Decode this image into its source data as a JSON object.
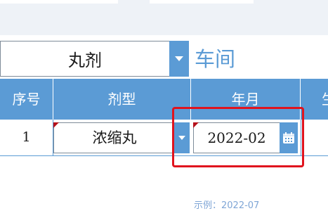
{
  "workshop": {
    "selected": "丸剂",
    "label": "车间"
  },
  "table": {
    "headers": [
      "序号",
      "剂型",
      "年月",
      "生"
    ],
    "rows": [
      {
        "seq": "1",
        "dosage_form": "浓缩丸",
        "year_month": "2022-02"
      }
    ]
  },
  "icons": {
    "dropdown": "chevron-down-icon",
    "calendar": "calendar-icon"
  },
  "hint": {
    "example": "示例：2022-07"
  },
  "colors": {
    "accent": "#5b9bd5",
    "highlight": "#e0141e",
    "flag": "#b5121b"
  }
}
